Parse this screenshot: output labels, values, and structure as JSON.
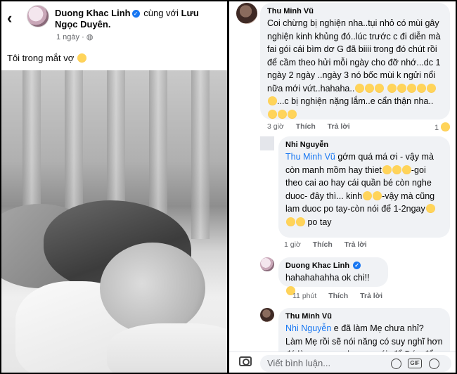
{
  "post": {
    "author": "Duong Khac Linh",
    "with_text": "cùng với",
    "tagged": "Lưu Ngọc Duyên.",
    "time": "1 ngày",
    "privacy_icon": "globe-icon",
    "caption": "Tôi trong mắt vợ"
  },
  "comments": [
    {
      "name": "Thu Minh Vũ",
      "text": "Coi chừng bị nghiện nha..tụi nhỏ có mùi gây nghiện kinh khủng đó..lúc trước c đi diễn mà fai gói cái bìm dơ G đã biiii trong đó chút rồi để cầm theo hửi mỗi ngày cho đỡ nhớ...dc 1 ngày 2 ngày ..ngày 3 nó bốc mùi k ngửi nổi nữa mới vứt..hahaha..",
      "text2": "...c bị nghiện nặng lắm..e cẩn thận nha..",
      "time": "3 giờ",
      "like": "Thích",
      "reply": "Trả lời",
      "reaction_count": "1"
    },
    {
      "name": "Nhi Nguyễn",
      "mention": "Thu Minh Vũ",
      "text": " gớm quá má ơi - vậy mà còn manh mồm hay thiet",
      "text2": "-goi theo cai ao hay cái quần bé còn nghe duoc- đây thì... kinh",
      "text3": "-vậy mà cũng lam duoc po tay-còn nói để 1-2ngay",
      "text4": "po tay",
      "time": "1 giờ",
      "like": "Thích",
      "reply": "Trả lời"
    },
    {
      "name": "Duong Khac Linh",
      "text": "hahahahahha ok chi!!",
      "time": "11 phút",
      "like": "Thích",
      "reply": "Trả lời"
    },
    {
      "name": "Thu Minh Vũ",
      "mention": "Nhi Nguyễn",
      "text": " e đã làm Mẹ chưa nhỉ? Làm Mẹ rồi sẽ nói năng có suy nghĩ hơn đó.làm gương cho con cái. để Đức để"
    }
  ],
  "composer": {
    "placeholder": "Viết bình luận...",
    "gif_label": "GIF"
  }
}
